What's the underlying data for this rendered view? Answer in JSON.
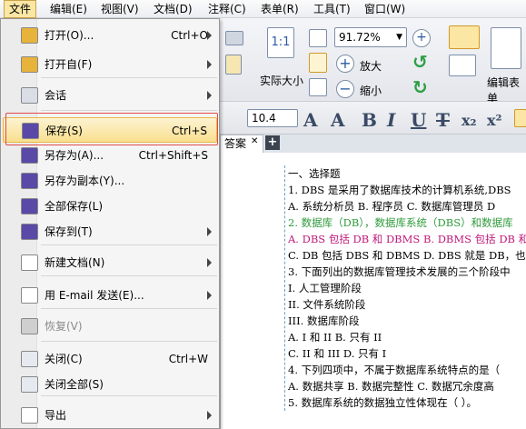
{
  "menubar": {
    "items": [
      "文件",
      "编辑(E)",
      "视图(V)",
      "文档(D)",
      "注释(C)",
      "表单(R)",
      "工具(T)",
      "窗口(W)"
    ]
  },
  "toolbar": {
    "zoom": "91.72%",
    "actual_size": "实际大小",
    "zoom_in": "放大",
    "zoom_out": "缩小",
    "edit_form": "编辑表单",
    "font_size": "10.4",
    "sub_label": "x₂",
    "sup_label": "x²"
  },
  "tabs": {
    "doc_tab": "答案"
  },
  "file_menu": {
    "items": [
      {
        "label": "打开(O)...",
        "shortcut": "Ctrl+O",
        "submenu": true,
        "icon": "folder-open-icon"
      },
      {
        "label": "打开自(F)",
        "shortcut": "",
        "submenu": true,
        "icon": "folder-globe-icon"
      },
      {
        "label": "会话",
        "shortcut": "",
        "submenu": true,
        "icon": "session-icon"
      },
      {
        "label": "保存(S)",
        "shortcut": "Ctrl+S",
        "submenu": false,
        "icon": "save-icon"
      },
      {
        "label": "另存为(A)...",
        "shortcut": "Ctrl+Shift+S",
        "submenu": false,
        "icon": "save-as-icon"
      },
      {
        "label": "另存为副本(Y)...",
        "shortcut": "",
        "submenu": false,
        "icon": "save-copy-icon"
      },
      {
        "label": "全部保存(L)",
        "shortcut": "",
        "submenu": false,
        "icon": "save-all-icon"
      },
      {
        "label": "保存到(T)",
        "shortcut": "",
        "submenu": true,
        "icon": "save-to-icon"
      },
      {
        "label": "新建文档(N)",
        "shortcut": "",
        "submenu": true,
        "icon": "new-document-icon"
      },
      {
        "label": "用 E-mail 发送(E)...",
        "shortcut": "",
        "submenu": true,
        "icon": "email-icon"
      },
      {
        "label": "恢复(V)",
        "shortcut": "",
        "submenu": false,
        "icon": "revert-icon"
      },
      {
        "label": "关闭(C)",
        "shortcut": "Ctrl+W",
        "submenu": false,
        "icon": "close-doc-icon"
      },
      {
        "label": "关闭全部(S)",
        "shortcut": "",
        "submenu": false,
        "icon": "close-all-icon"
      },
      {
        "label": "导出",
        "shortcut": "",
        "submenu": true,
        "icon": "export-icon"
      }
    ]
  },
  "document": {
    "lines": [
      {
        "text": "一、选择题",
        "color": "#000000"
      },
      {
        "text": "1. DBS 是采用了数据库技术的计算机系统,DBS",
        "color": "#000000"
      },
      {
        "text": "A. 系统分析员 B. 程序员 C. 数据库管理员 D",
        "color": "#000000"
      },
      {
        "text": "2. 数据库（DB），数据库系统（DBS）和数据库",
        "color": "#2e9a3a"
      },
      {
        "text": "A. DBS 包括 DB 和 DBMS B. DBMS 包括 DB 和",
        "color": "#c0187a"
      },
      {
        "text": "C. DB 包括 DBS 和 DBMS D. DBS 就是 DB，也",
        "color": "#000000"
      },
      {
        "text": "3. 下面列出的数据库管理技术发展的三个阶段中",
        "color": "#000000"
      },
      {
        "text": "I. 人工管理阶段",
        "color": "#000000"
      },
      {
        "text": "II. 文件系统阶段",
        "color": "#000000"
      },
      {
        "text": "III. 数据库阶段",
        "color": "#000000"
      },
      {
        "text": "A. I 和 II B. 只有 II",
        "color": "#000000"
      },
      {
        "text": "C. II 和 III D. 只有 I",
        "color": "#000000"
      },
      {
        "text": "4. 下列四项中，不属于数据库系统特点的是（",
        "color": "#000000"
      },
      {
        "text": "A. 数据共享 B. 数据完整性 C. 数据冗余度高",
        "color": "#000000"
      },
      {
        "text": "5. 数据库系统的数据独立性体现在（ ）。",
        "color": "#000000"
      }
    ]
  }
}
